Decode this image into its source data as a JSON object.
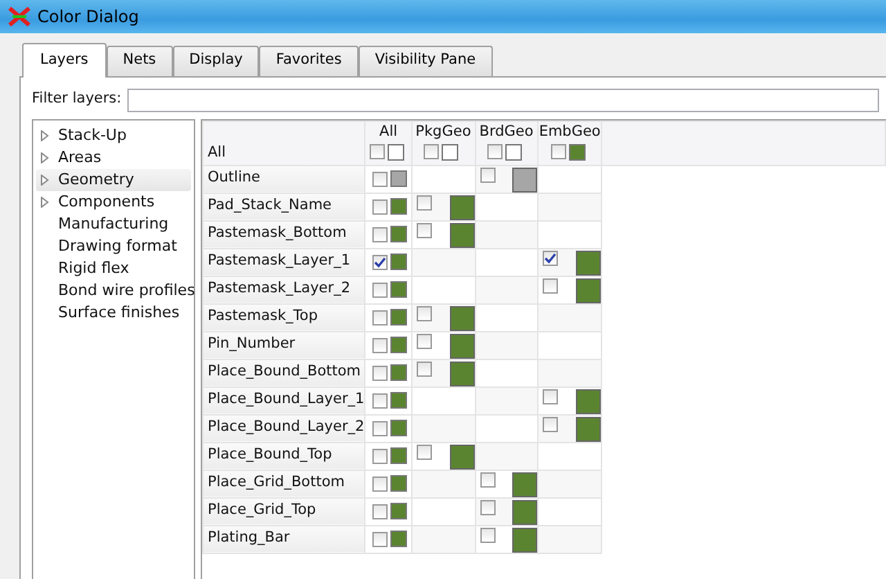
{
  "window": {
    "title": "Color Dialog"
  },
  "tabs": [
    {
      "label": "Layers",
      "selected": true
    },
    {
      "label": "Nets",
      "selected": false
    },
    {
      "label": "Display",
      "selected": false
    },
    {
      "label": "Favorites",
      "selected": false
    },
    {
      "label": "Visibility Pane",
      "selected": false
    }
  ],
  "filter": {
    "label": "Filter layers:"
  },
  "tree": {
    "items": [
      {
        "label": "Stack-Up",
        "kind": "folder",
        "selected": false
      },
      {
        "label": "Areas",
        "kind": "folder",
        "selected": false
      },
      {
        "label": "Geometry",
        "kind": "folder",
        "selected": true
      },
      {
        "label": "Components",
        "kind": "folder",
        "selected": false
      },
      {
        "label": "Manufacturing",
        "kind": "leaf",
        "selected": false
      },
      {
        "label": "Drawing format",
        "kind": "leaf",
        "selected": false
      },
      {
        "label": "Rigid flex",
        "kind": "leaf",
        "selected": false
      },
      {
        "label": "Bond wire profiles",
        "kind": "leaf",
        "selected": false
      },
      {
        "label": "Surface finishes",
        "kind": "leaf",
        "selected": false
      }
    ]
  },
  "grid": {
    "row_header": "All",
    "columns": [
      {
        "label": "All",
        "checked": false,
        "color": "#ffffff"
      },
      {
        "label": "PkgGeo",
        "checked": false,
        "color": "#ffffff"
      },
      {
        "label": "BrdGeo",
        "checked": false,
        "color": "#ffffff"
      },
      {
        "label": "EmbGeo",
        "checked": false,
        "color": "#5b8431"
      }
    ],
    "rows": [
      {
        "name": "Outline",
        "all": {
          "checked": false,
          "color": "#a6a6a6"
        },
        "cells": [
          null,
          {
            "checked": false,
            "color": "#a6a6a6"
          },
          null
        ]
      },
      {
        "name": "Pad_Stack_Name",
        "all": {
          "checked": false,
          "color": "#5b8431"
        },
        "cells": [
          {
            "checked": false,
            "color": "#5b8431"
          },
          null,
          null
        ]
      },
      {
        "name": "Pastemask_Bottom",
        "all": {
          "checked": false,
          "color": "#5b8431"
        },
        "cells": [
          {
            "checked": false,
            "color": "#5b8431"
          },
          null,
          null
        ]
      },
      {
        "name": "Pastemask_Layer_1",
        "all": {
          "checked": true,
          "color": "#5b8431"
        },
        "cells": [
          null,
          null,
          {
            "checked": true,
            "color": "#5b8431"
          }
        ]
      },
      {
        "name": "Pastemask_Layer_2",
        "all": {
          "checked": false,
          "color": "#5b8431"
        },
        "cells": [
          null,
          null,
          {
            "checked": false,
            "color": "#5b8431"
          }
        ]
      },
      {
        "name": "Pastemask_Top",
        "all": {
          "checked": false,
          "color": "#5b8431"
        },
        "cells": [
          {
            "checked": false,
            "color": "#5b8431"
          },
          null,
          null
        ]
      },
      {
        "name": "Pin_Number",
        "all": {
          "checked": false,
          "color": "#5b8431"
        },
        "cells": [
          {
            "checked": false,
            "color": "#5b8431"
          },
          null,
          null
        ]
      },
      {
        "name": "Place_Bound_Bottom",
        "all": {
          "checked": false,
          "color": "#5b8431"
        },
        "cells": [
          {
            "checked": false,
            "color": "#5b8431"
          },
          null,
          null
        ]
      },
      {
        "name": "Place_Bound_Layer_1",
        "all": {
          "checked": false,
          "color": "#5b8431"
        },
        "cells": [
          null,
          null,
          {
            "checked": false,
            "color": "#5b8431"
          }
        ]
      },
      {
        "name": "Place_Bound_Layer_2",
        "all": {
          "checked": false,
          "color": "#5b8431"
        },
        "cells": [
          null,
          null,
          {
            "checked": false,
            "color": "#5b8431"
          }
        ]
      },
      {
        "name": "Place_Bound_Top",
        "all": {
          "checked": false,
          "color": "#5b8431"
        },
        "cells": [
          {
            "checked": false,
            "color": "#5b8431"
          },
          null,
          null
        ]
      },
      {
        "name": "Place_Grid_Bottom",
        "all": {
          "checked": false,
          "color": "#5b8431"
        },
        "cells": [
          null,
          {
            "checked": false,
            "color": "#5b8431"
          },
          null
        ]
      },
      {
        "name": "Place_Grid_Top",
        "all": {
          "checked": false,
          "color": "#5b8431"
        },
        "cells": [
          null,
          {
            "checked": false,
            "color": "#5b8431"
          },
          null
        ]
      },
      {
        "name": "Plating_Bar",
        "all": {
          "checked": false,
          "color": "#5b8431"
        },
        "cells": [
          null,
          {
            "checked": false,
            "color": "#5b8431"
          },
          null
        ]
      }
    ]
  }
}
